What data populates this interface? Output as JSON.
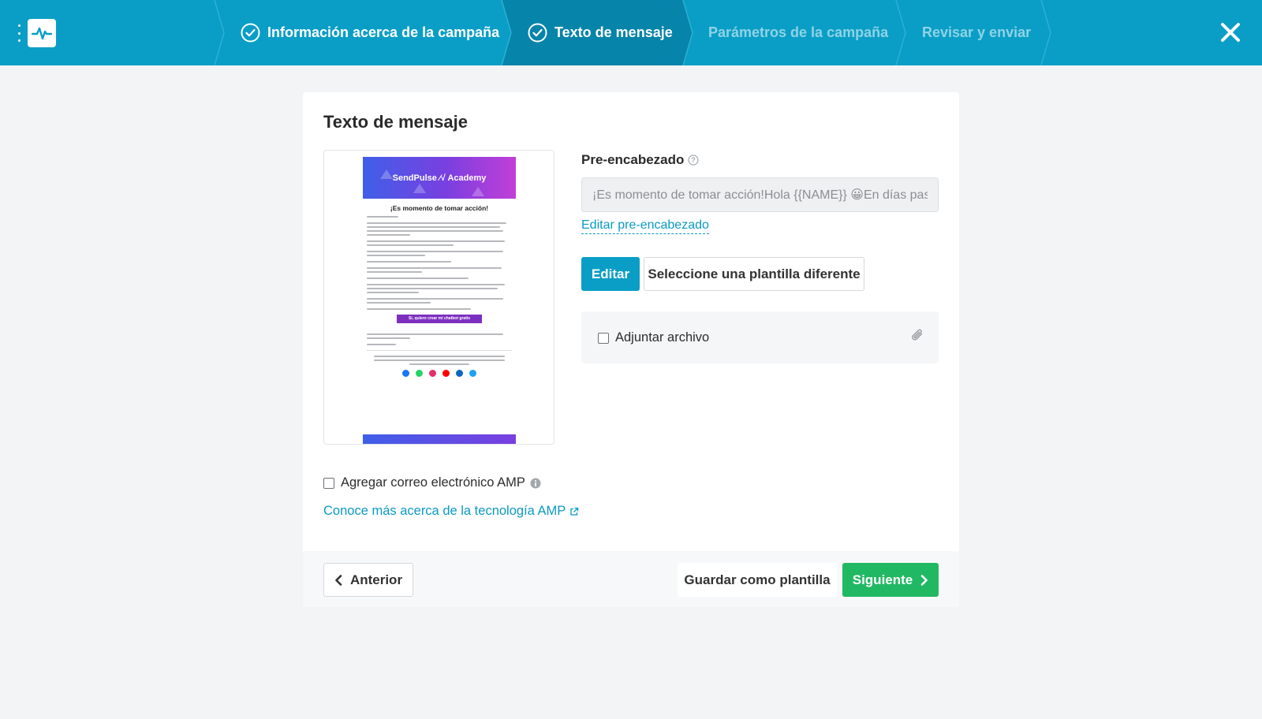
{
  "header": {
    "steps": [
      {
        "label": "Información acerca de la campaña",
        "state": "completed"
      },
      {
        "label": "Texto de mensaje",
        "state": "current"
      },
      {
        "label": "Parámetros de la campaña",
        "state": "pending"
      },
      {
        "label": "Revisar y enviar",
        "state": "pending"
      }
    ],
    "icons": {
      "menu": "kebab-menu-icon",
      "logo": "pulse-logo-icon",
      "close": "close-icon"
    }
  },
  "page": {
    "title": "Texto de mensaje"
  },
  "preview": {
    "banner_text": "SendPulse ⁄√ Academy",
    "heading": "¡Es momento de tomar acción!",
    "cta_text": "Sí, quiero crear mi chatbot gratis"
  },
  "preheader": {
    "label": "Pre-encabezado",
    "value": "¡Es momento de tomar acción!Hola {{NAME}} 😀En días pasados te enviamos un correo",
    "edit_link": "Editar pre-encabezado"
  },
  "buttons": {
    "edit": "Editar",
    "select_template": "Seleccione una plantilla diferente",
    "previous": "Anterior",
    "save_template": "Guardar como plantilla",
    "next": "Siguiente"
  },
  "attachment": {
    "label": "Adjuntar archivo",
    "checked": false
  },
  "amp": {
    "label": "Agregar correo electrónico AMP",
    "checked": false,
    "link": "Conoce más acerca de la tecnología AMP"
  },
  "colors": {
    "header_bg": "#0a9ec6",
    "accent": "#0a9ec6",
    "link": "#0b9ac2",
    "success": "#21b864",
    "page_bg": "#f3f4f5"
  }
}
